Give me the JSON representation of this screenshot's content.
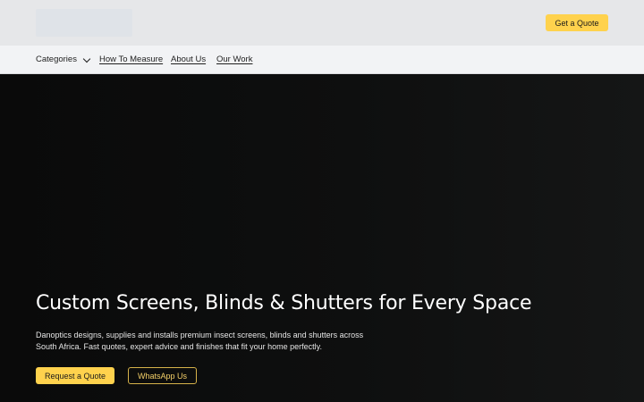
{
  "header": {
    "cta_label": "Get a Quote"
  },
  "nav": {
    "items": [
      {
        "label": "Categories",
        "has_dropdown": true
      },
      {
        "label": "How To Measure"
      },
      {
        "label": "About Us"
      },
      {
        "label": "Our Work"
      }
    ]
  },
  "hero": {
    "title": "Custom Screens, Blinds & Shutters for Every Space",
    "description": "Danoptics designs, supplies and installs premium insect screens, blinds and shutters across South Africa. Fast quotes, expert advice and finishes that fit your home perfectly.",
    "primary_cta": "Request a Quote",
    "secondary_cta": "WhatsApp Us"
  },
  "colors": {
    "accent": "#ffd24d",
    "hero_background": "#0c0c0c",
    "header_background": "#e6e7e9",
    "nav_background": "#f2f3f5"
  },
  "icons": {
    "categories_dropdown": "chevron-down-icon"
  }
}
